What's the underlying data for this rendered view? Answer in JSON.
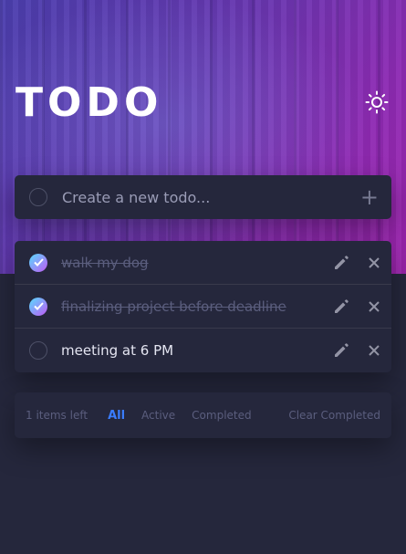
{
  "header": {
    "title": "TODO"
  },
  "new_todo": {
    "placeholder": "Create a new todo..."
  },
  "todos": [
    {
      "text": "walk my dog",
      "completed": true
    },
    {
      "text": "finalizing project before deadline",
      "completed": true
    },
    {
      "text": "meeting at 6 PM",
      "completed": false
    }
  ],
  "footer": {
    "items_left": "1 items left",
    "filters": [
      "All",
      "Active",
      "Completed"
    ],
    "active_filter": "All",
    "clear": "Clear Completed"
  },
  "icons": {
    "theme": "sun-icon",
    "add": "plus-icon",
    "edit": "pencil-icon",
    "delete": "close-icon",
    "check": "check-icon"
  },
  "colors": {
    "background": "#25273c",
    "accent": "#3a7cfd",
    "check_gradient": [
      "#57ddff",
      "#c058f3"
    ]
  }
}
